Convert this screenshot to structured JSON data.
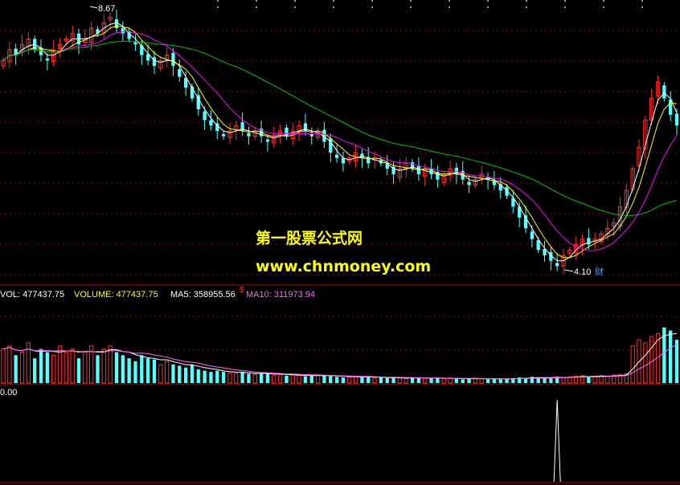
{
  "chart_data": {
    "type": "candlestick",
    "price_panel": {
      "high_label": "8.67",
      "low_label": "4.10",
      "marker_label": "财",
      "marker_bottom": "$",
      "up_color": "#ff3030",
      "down_color": "#54ffff",
      "ma_colors": [
        "#ffffff",
        "#ffff00",
        "#ff00ff",
        "#00c000"
      ],
      "closes": [
        7.9,
        8.1,
        8.0,
        8.2,
        8.3,
        8.1,
        8.0,
        7.9,
        8.1,
        8.2,
        8.3,
        8.4,
        8.2,
        8.3,
        8.5,
        8.4,
        8.6,
        8.7,
        8.5,
        8.4,
        8.3,
        8.2,
        8.0,
        7.9,
        7.8,
        7.9,
        8.0,
        7.8,
        7.6,
        7.4,
        7.2,
        7.0,
        6.8,
        6.7,
        6.6,
        6.5,
        6.6,
        6.7,
        6.6,
        6.5,
        6.6,
        6.5,
        6.4,
        6.5,
        6.6,
        6.5,
        6.6,
        6.7,
        6.6,
        6.5,
        6.6,
        6.4,
        6.2,
        6.1,
        6.0,
        6.1,
        6.2,
        6.1,
        6.0,
        6.1,
        6.0,
        5.9,
        5.8,
        5.9,
        6.0,
        5.9,
        5.8,
        5.9,
        5.8,
        5.7,
        5.8,
        5.9,
        5.8,
        5.7,
        5.6,
        5.7,
        5.8,
        5.7,
        5.6,
        5.5,
        5.4,
        5.2,
        5.0,
        4.8,
        4.6,
        4.4,
        4.3,
        4.2,
        4.1,
        4.3,
        4.4,
        4.5,
        4.6,
        4.5,
        4.6,
        4.7,
        4.8,
        4.9,
        5.2,
        5.5,
        5.9,
        6.3,
        6.8,
        7.2,
        7.5,
        7.2,
        6.9,
        6.7
      ]
    },
    "volume_panel": {
      "label_vol": "VOL: 477437.75",
      "label_volume": "VOLUME: 477437.75",
      "label_ma5": "MA5: 358955.56",
      "label_ma10": "MA10: 311973.94",
      "ma5_color": "#ffffff",
      "ma10_color": "#ff66ff",
      "values": [
        0.55,
        0.6,
        0.45,
        0.5,
        0.65,
        0.4,
        0.55,
        0.5,
        0.45,
        0.6,
        0.5,
        0.55,
        0.4,
        0.5,
        0.6,
        0.45,
        0.55,
        0.6,
        0.5,
        0.45,
        0.4,
        0.35,
        0.45,
        0.4,
        0.38,
        0.3,
        0.35,
        0.3,
        0.28,
        0.25,
        0.3,
        0.22,
        0.2,
        0.18,
        0.2,
        0.18,
        0.16,
        0.15,
        0.18,
        0.15,
        0.14,
        0.16,
        0.15,
        0.13,
        0.14,
        0.12,
        0.13,
        0.12,
        0.11,
        0.12,
        0.13,
        0.12,
        0.11,
        0.1,
        0.09,
        0.1,
        0.11,
        0.09,
        0.1,
        0.08,
        0.09,
        0.08,
        0.09,
        0.08,
        0.07,
        0.08,
        0.09,
        0.08,
        0.07,
        0.08,
        0.07,
        0.08,
        0.07,
        0.06,
        0.07,
        0.08,
        0.07,
        0.06,
        0.07,
        0.06,
        0.07,
        0.08,
        0.09,
        0.08,
        0.1,
        0.09,
        0.08,
        0.09,
        0.1,
        0.09,
        0.1,
        0.11,
        0.12,
        0.1,
        0.11,
        0.12,
        0.11,
        0.13,
        0.14,
        0.15,
        0.6,
        0.7,
        0.65,
        0.75,
        0.8,
        0.9,
        0.85,
        0.7
      ]
    },
    "indicator_panel": {
      "label": "0.00",
      "spike_index": 88,
      "line_color": "#ffffff"
    }
  },
  "watermark": {
    "line1": "第一股票公式网",
    "line2": "www.chnmoney.com",
    "color": "#ffff00"
  }
}
